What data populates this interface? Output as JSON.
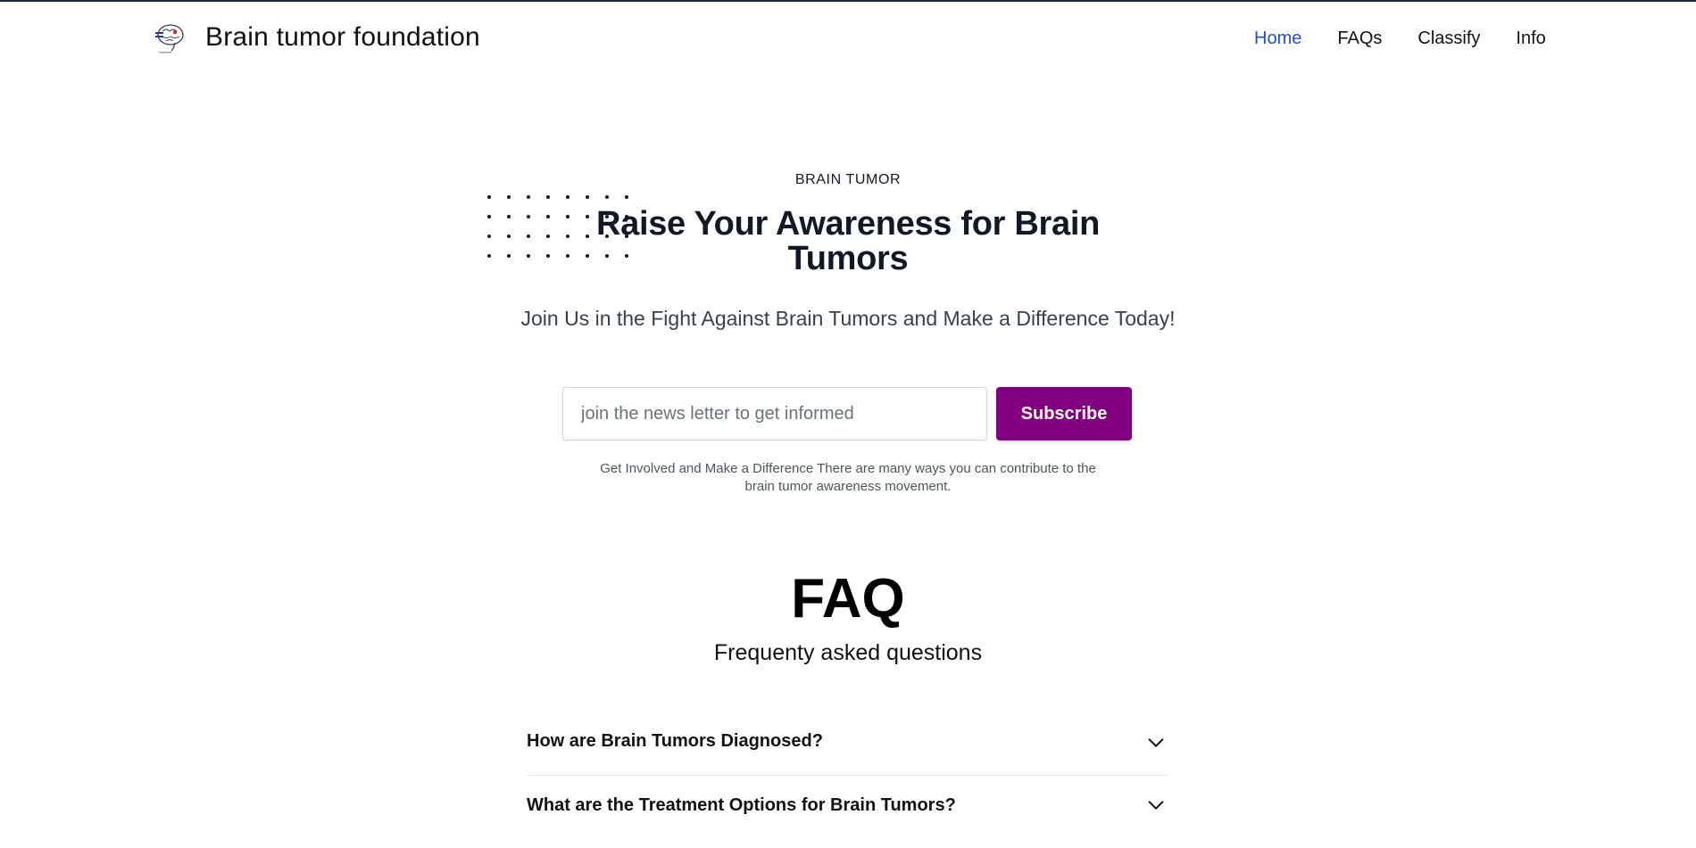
{
  "header": {
    "brand_name": "Brain tumor foundation",
    "logo_icon": "brain-icon",
    "nav": [
      {
        "label": "Home",
        "active": true
      },
      {
        "label": "FAQs",
        "active": false
      },
      {
        "label": "Classify",
        "active": false
      },
      {
        "label": "Info",
        "active": false
      }
    ]
  },
  "hero": {
    "eyebrow": "BRAIN TUMOR",
    "title": "Raise Your Awareness for Brain Tumors",
    "subtitle": "Join Us in the Fight Against Brain Tumors and Make a Difference Today!",
    "email_placeholder": "join the news letter to get informed",
    "email_value": "",
    "subscribe_label": "Subscribe",
    "note": "Get Involved and Make a Difference There are many ways you can contribute to the brain tumor awareness movement."
  },
  "faq": {
    "title": "FAQ",
    "subtitle": "Frequenty asked questions",
    "items": [
      {
        "question": "How are Brain Tumors Diagnosed?"
      },
      {
        "question": "What are the Treatment Options for Brain Tumors?"
      }
    ]
  },
  "colors": {
    "accent": "#800080",
    "nav_active": "#1d4ed8",
    "text": "#111827"
  }
}
